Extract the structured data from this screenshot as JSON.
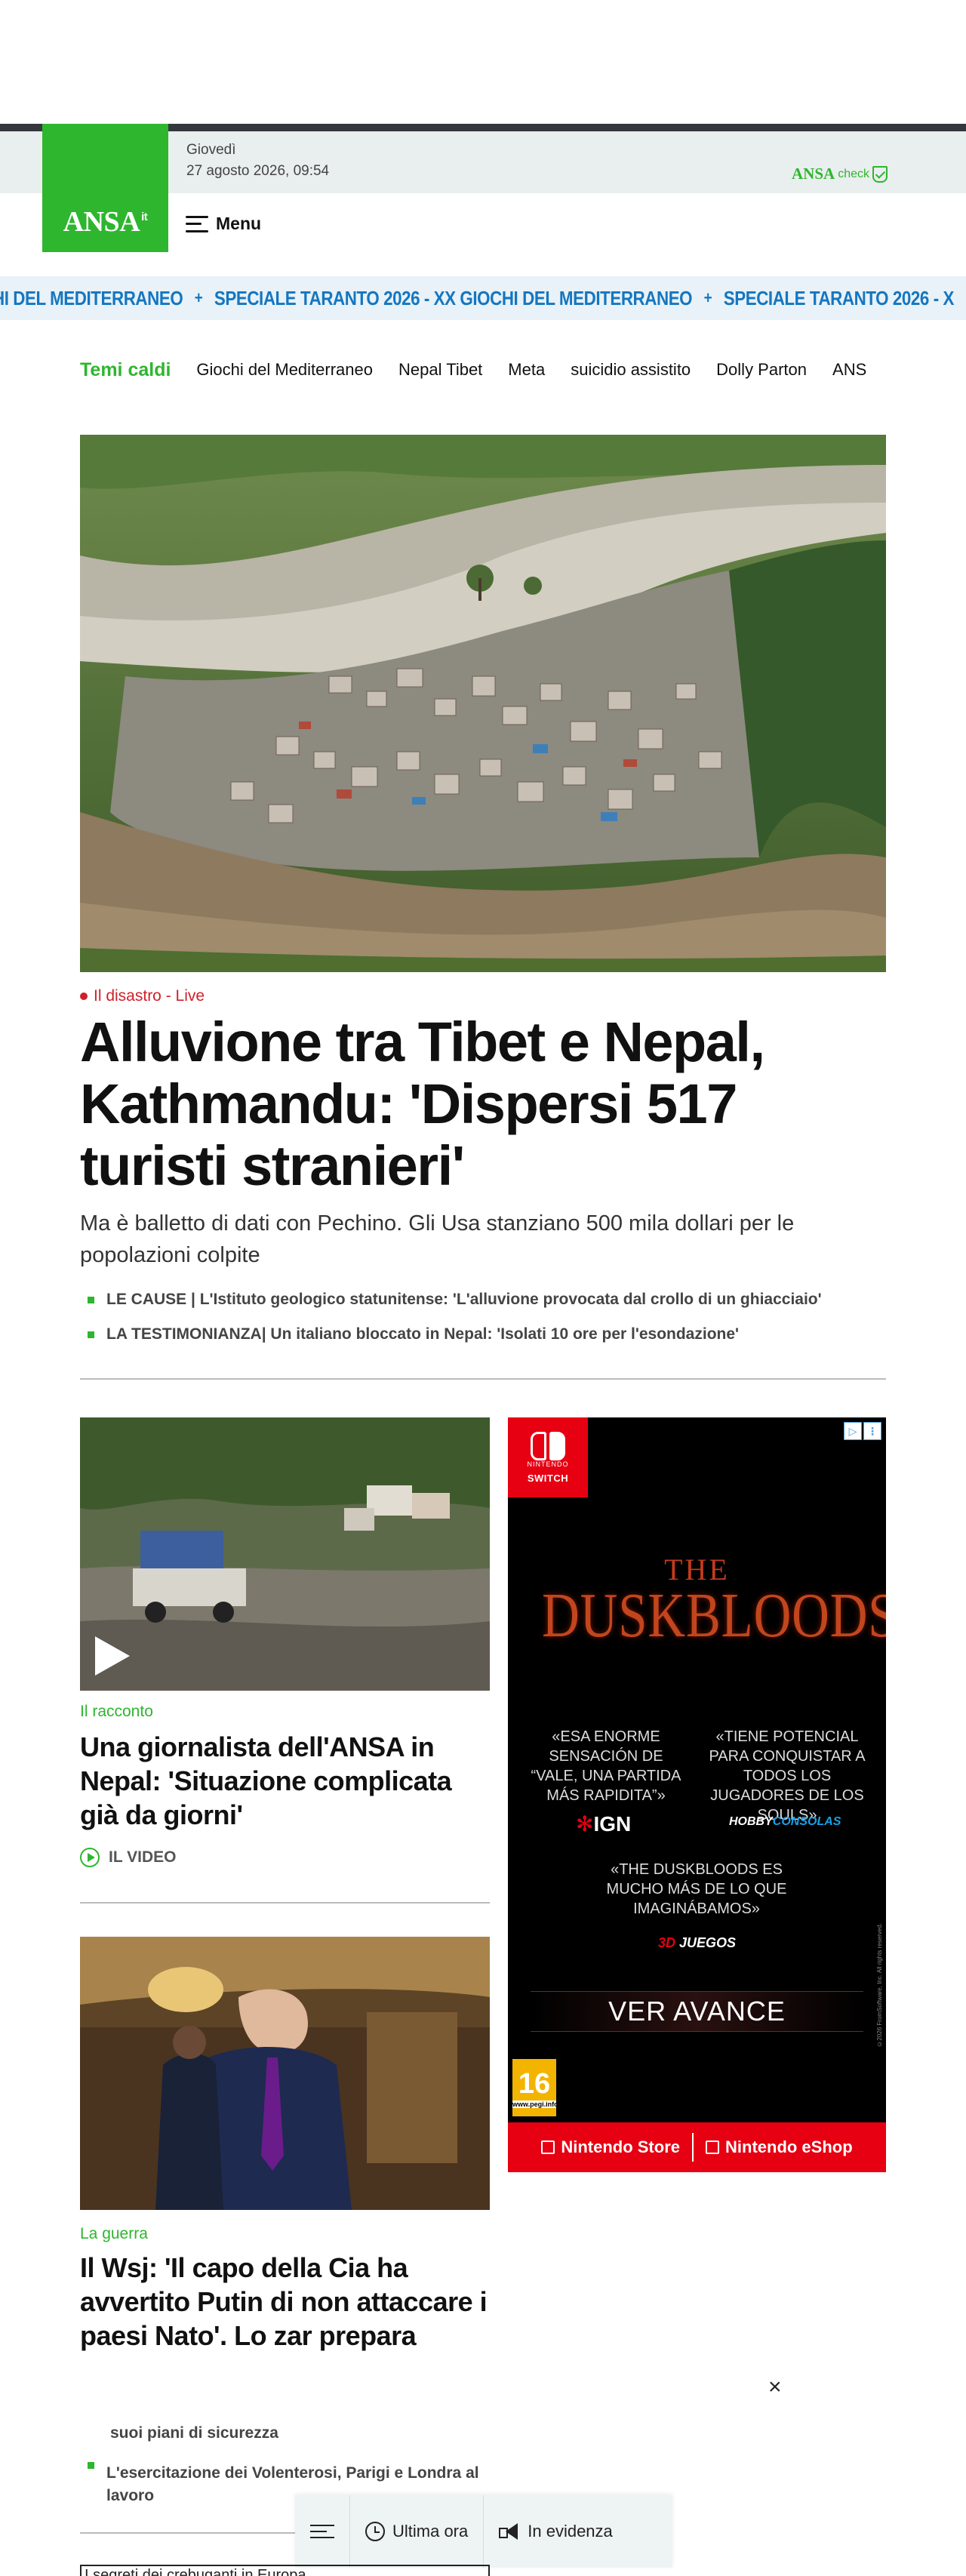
{
  "header": {
    "logo_text": "ANSA",
    "logo_sup": "it",
    "date_day": "Giovedì",
    "date_full": "27 agosto 2026, 09:54",
    "ansacheck_main": "ANSA",
    "ansacheck_sub": "check",
    "menu_label": "Menu"
  },
  "ticker": {
    "items": [
      "HI DEL MEDITERRANEO",
      "SPECIALE TARANTO 2026 - XX GIOCHI DEL MEDITERRANEO",
      "SPECIALE TARANTO 2026 - X"
    ],
    "separator": "+"
  },
  "topics": {
    "label": "Temi caldi",
    "items": [
      "Giochi del Mediterraneo",
      "Nepal Tibet",
      "Meta",
      "suicidio assistito",
      "Dolly Parton",
      "ANS"
    ]
  },
  "hero": {
    "kicker": "Il disastro - Live",
    "headline": "Alluvione tra Tibet e Nepal, Kathmandu: 'Dispersi 517 turisti stranieri'",
    "subhead": "Ma è balletto di dati con Pechino. Gli Usa stanziano 500 mila dollari per le popolazioni colpite",
    "bullets": [
      "LE CAUSE | L'Istituto geologico statunitense: 'L'alluvione provocata dal crollo di un ghiacciaio'",
      "LA TESTIMONIANZA| Un italiano bloccato in Nepal: 'Isolati 10 ore per l'esondazione'"
    ]
  },
  "card1": {
    "kicker": "Il racconto",
    "title": "Una giornalista dell'ANSA in Nepal: 'Situazione complicata già da giorni'",
    "video_label": "IL VIDEO"
  },
  "card2": {
    "kicker": "La guerra",
    "title": "Il Wsj: 'Il capo della Cia ha avvertito Putin di non attaccare i paesi Nato'. Lo zar prepara",
    "sub_truncated": "suoi piani di sicurezza",
    "bullet": "L'esercitazione dei Volenterosi, Parigi e Londra al lavoro"
  },
  "ad": {
    "brand_pre": "NINTENDO",
    "brand": "SWITCH",
    "adchoices": [
      "▷",
      "⋮"
    ],
    "game_the": "THE",
    "game_title": "DUSKBLOODS",
    "quote1": "«ESA ENORME SENSACIÓN DE “VALE, UNA PARTIDA MÁS RAPIDITA”»",
    "quote2": "«TIENE POTENCIAL PARA CONQUISTAR A TODOS LOS JUGADORES DE LOS SOULS»",
    "quote3": "«THE DUSKBLOODS ES MUCHO MÁS DE LO QUE IMAGINÁBAMOS»",
    "source1": "IGN",
    "source2_a": "HOBBY",
    "source2_b": "CONSOLAS",
    "source3_a": "3D",
    "source3_b": "JUEGOS",
    "cta": "VER AVANCE",
    "pegi": "16",
    "pegi_url": "www.pegi.info",
    "copyright": "©2026 FromSoftware, Inc. All rights reserved.",
    "store1": "Nintendo Store",
    "store2": "Nintendo eShop"
  },
  "bottom_nav": {
    "items": [
      "Ultima ora",
      "In evidenza"
    ]
  },
  "cut_box_text": "I segreti dei crebuganti in Europa",
  "close_symbol": "×"
}
